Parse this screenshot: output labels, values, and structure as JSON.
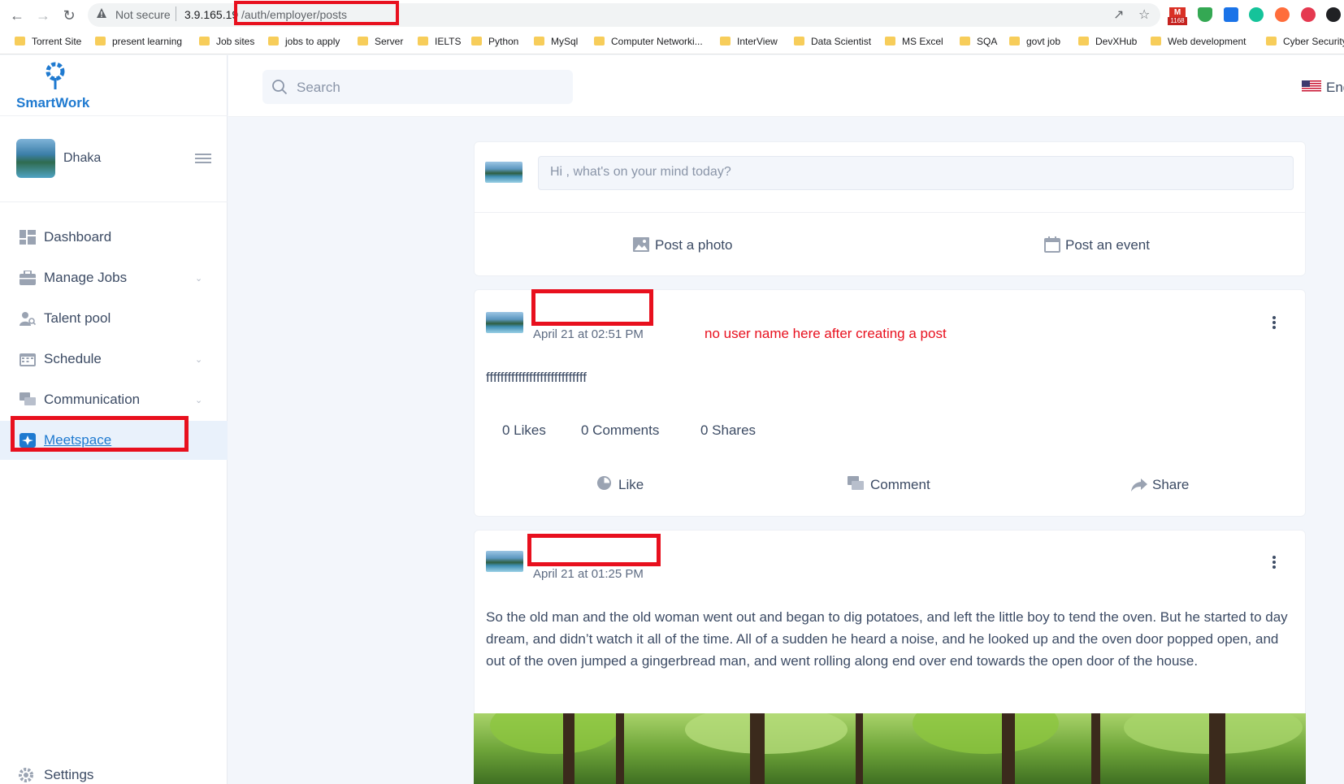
{
  "browser": {
    "security_label": "Not secure",
    "url_host": "3.9.165.19",
    "url_path": "/auth/employer/posts",
    "gmail_count": "1168"
  },
  "bookmarks": [
    "Torrent Site",
    "present learning",
    "Job sites",
    "jobs to apply",
    "Server",
    "IELTS",
    "Python",
    "MySql",
    "Computer Networki...",
    "InterView",
    "Data Scientist",
    "MS Excel",
    "SQA",
    "govt job",
    "DevXHub",
    "Web development",
    "Cyber Security"
  ],
  "brand": {
    "name": "SmartWork"
  },
  "profile": {
    "name": "Dhaka"
  },
  "menu": [
    {
      "label": "Dashboard",
      "icon": "dashboard-icon"
    },
    {
      "label": "Manage Jobs",
      "icon": "briefcase-icon"
    },
    {
      "label": "Talent pool",
      "icon": "user-search-icon"
    },
    {
      "label": "Schedule",
      "icon": "calendar-icon"
    },
    {
      "label": "Communication",
      "icon": "chat-icon"
    },
    {
      "label": "Meetspace",
      "icon": "meetspace-icon"
    }
  ],
  "settings_label": "Settings",
  "search": {
    "placeholder": "Search"
  },
  "language": "Eng",
  "composer": {
    "placeholder": "Hi , what's on your mind today?",
    "post_photo": "Post a photo",
    "post_event": "Post an event"
  },
  "posts": [
    {
      "date": "April 21 at 02:51 PM",
      "body": "ffffffffffffffffffffffffffff",
      "likes": "0 Likes",
      "comments": "0 Comments",
      "shares": "0 Shares"
    },
    {
      "date": "April 21 at 01:25 PM",
      "body": "So the old man and the old woman went out and began to dig potatoes, and left the little boy to tend the oven. But he started to day dream, and didn’t watch it all of the time. All of a sudden he heard a noise, and he looked up and the oven door popped open, and out of the oven jumped a gingerbread man, and went rolling along end over end towards the open door of the house."
    }
  ],
  "post_actions": {
    "like": "Like",
    "comment": "Comment",
    "share": "Share"
  },
  "annotation_note": "no user name here after creating a post"
}
